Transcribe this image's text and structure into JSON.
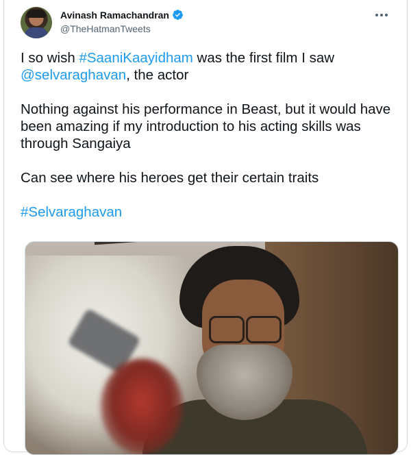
{
  "author": {
    "display_name": "Avinash Ramachandran",
    "handle": "@TheHatmanTweets",
    "verified": true,
    "avatar_icon": "profile-avatar"
  },
  "tweet": {
    "line1_pre": "I so wish ",
    "hashtag1": "#SaaniKaayidham",
    "line1_post": " was the first film I saw",
    "mention": "@selvaraghavan",
    "line2_post": ", the actor",
    "para2": "Nothing against his performance in Beast, but it would have been amazing if my introduction to his acting skills was through Sangaiya",
    "para3": "Can see where his heroes get their certain traits",
    "hashtag2": "#Selvaraghavan"
  },
  "colors": {
    "link": "#1d9bf0",
    "text": "#0f1419",
    "secondary": "#536471",
    "border": "#cfd9de"
  },
  "icons": {
    "verified": "verified-badge-icon",
    "more": "more-options-icon"
  }
}
